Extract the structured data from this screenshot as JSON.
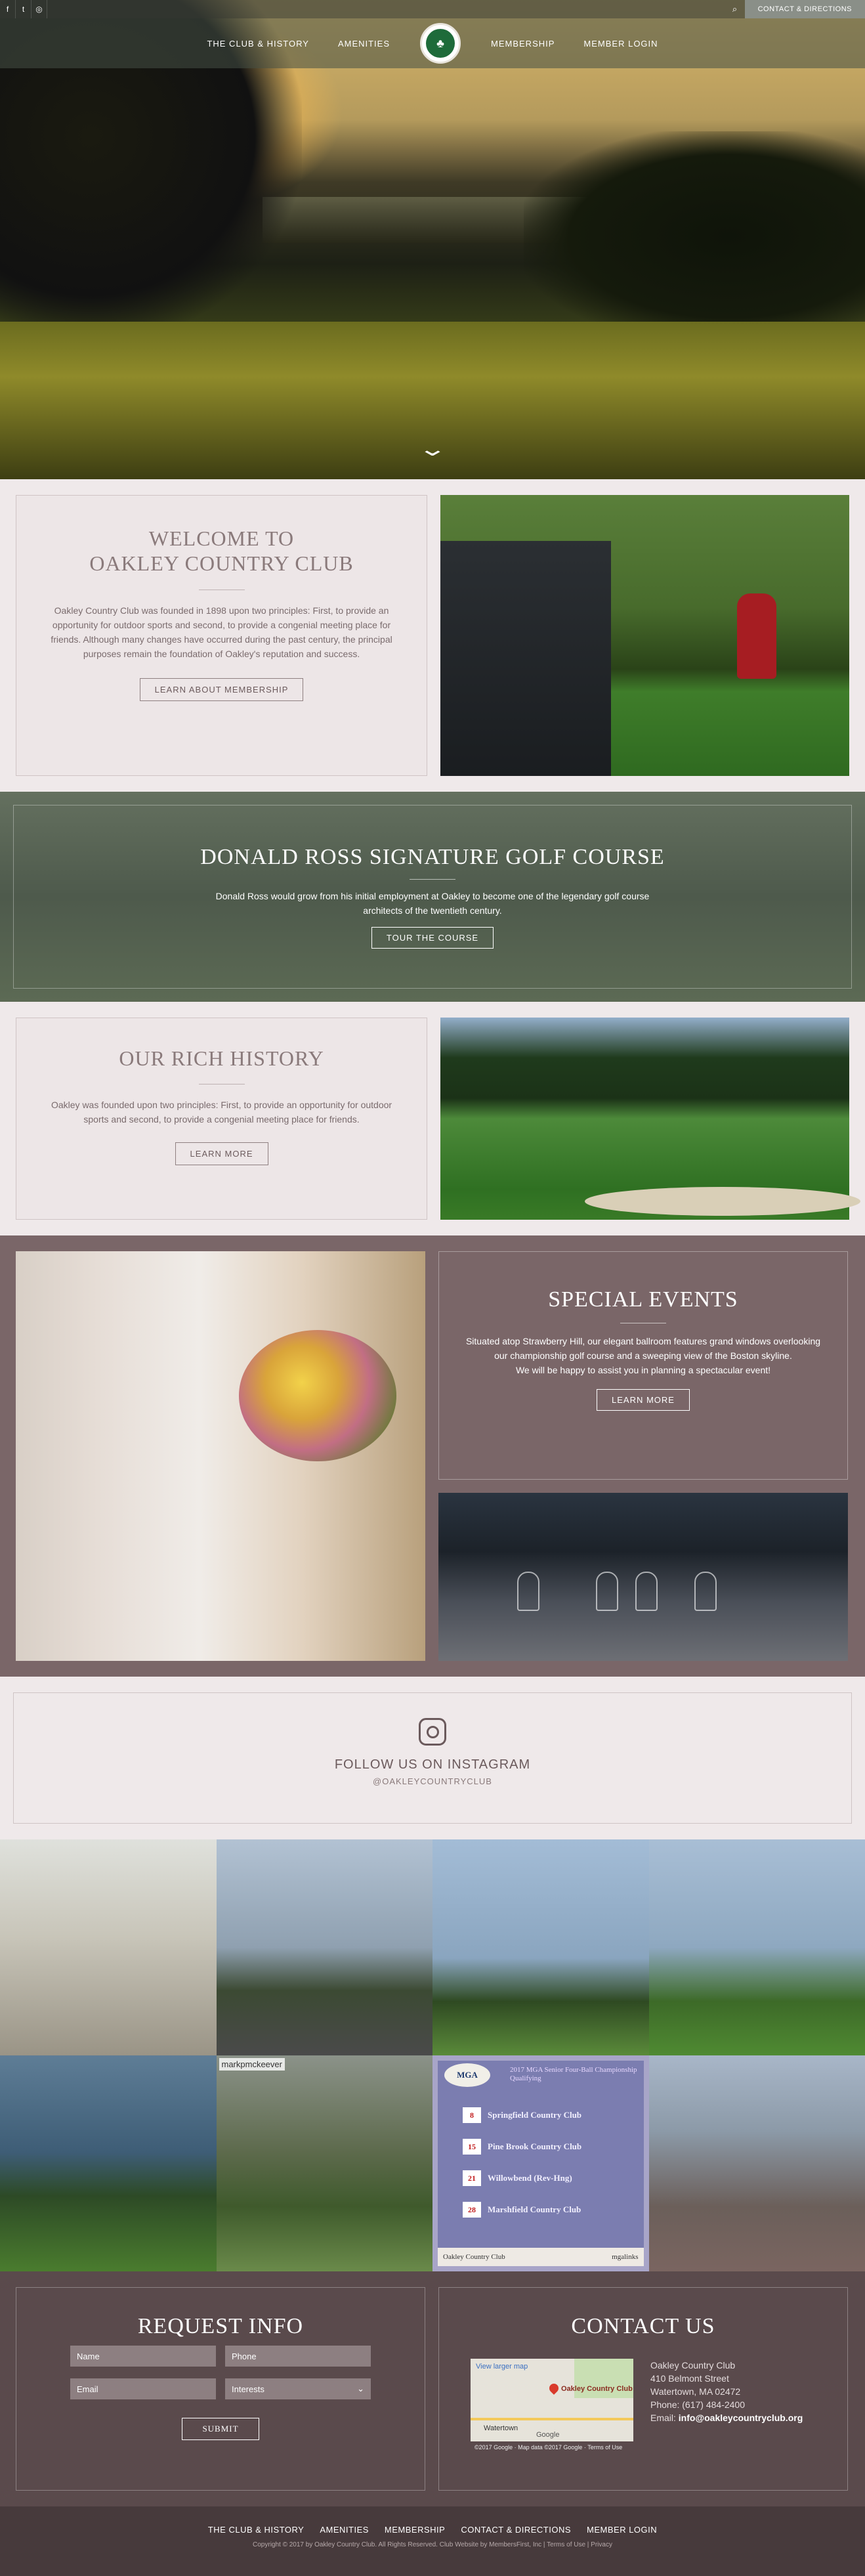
{
  "topbar": {
    "social": [
      {
        "icon": "facebook-icon",
        "glyph": "f"
      },
      {
        "icon": "twitter-icon",
        "glyph": "t"
      },
      {
        "icon": "instagram-icon",
        "glyph": "◎"
      }
    ],
    "search_icon": "⌕",
    "cta_label": "CONTACT & DIRECTIONS"
  },
  "nav": {
    "left": [
      "THE CLUB & HISTORY",
      "AMENITIES"
    ],
    "right": [
      "MEMBERSHIP",
      "MEMBER LOGIN"
    ],
    "crest_glyph": "♣"
  },
  "hero": {
    "chevron": "⌄"
  },
  "welcome": {
    "title_line1": "WELCOME TO",
    "title_line2": "OAKLEY COUNTRY CLUB",
    "body": "Oakley Country Club was founded in 1898 upon two principles: First, to provide an opportunity for outdoor sports and second, to provide a congenial meeting place for friends. Although many changes have occurred during the past century, the principal purposes remain the foundation of Oakley's reputation and success.",
    "button": "LEARN ABOUT MEMBERSHIP"
  },
  "ross": {
    "title": "DONALD ROSS SIGNATURE GOLF COURSE",
    "body": "Donald Ross would grow from his initial employment at Oakley to become one of the legendary golf course architects of the twentieth century.",
    "button": "TOUR THE COURSE"
  },
  "history": {
    "title": "OUR RICH HISTORY",
    "body": "Oakley was founded upon two principles: First, to provide an opportunity for outdoor sports and second, to provide a congenial meeting place for friends.",
    "button": "LEARN MORE"
  },
  "events": {
    "title": "SPECIAL EVENTS",
    "body1": "Situated atop Strawberry Hill, our elegant ballroom features grand windows overlooking our championship golf course and a sweeping view of the Boston skyline.",
    "body2": "We will be happy to assist you in planning a spectacular event!",
    "button": "LEARN MORE"
  },
  "instagram": {
    "title": "FOLLOW US ON INSTAGRAM",
    "handle": "@OAKLEYCOUNTRYCLUB",
    "tile_tag": "markpmckeever",
    "mga": {
      "logo": "MGA",
      "header": "2017 MGA Senior Four-Ball Championship Qualifying",
      "events": [
        {
          "day": "8",
          "club": "Springfield Country Club"
        },
        {
          "day": "15",
          "club": "Pine Brook Country Club"
        },
        {
          "day": "21",
          "club": "Willowbend (Rev-Hng)"
        },
        {
          "day": "28",
          "club": "Marshfield Country Club"
        }
      ],
      "footer_left": "Oakley Country Club",
      "footer_right": "mgalinks"
    }
  },
  "request": {
    "title": "REQUEST INFO",
    "fields": {
      "name": "Name",
      "phone": "Phone",
      "email": "Email",
      "interests": "Interests"
    },
    "submit": "SUBMIT"
  },
  "contact": {
    "title": "CONTACT US",
    "map": {
      "view_larger": "View larger map",
      "pin_label": "Oakley Country Club",
      "town": "Watertown",
      "google": "Google",
      "copyright": "©2017 Google · Map data ©2017 Google · Terms of Use"
    },
    "name": "Oakley Country Club",
    "street": "410 Belmont Street",
    "city": "Watertown, MA 02472",
    "phone": "Phone: (617) 484-2400",
    "email_prefix": "Email:",
    "email": "info@oakleycountryclub.org"
  },
  "footer": {
    "links": [
      "THE CLUB & HISTORY",
      "AMENITIES",
      "MEMBERSHIP",
      "CONTACT & DIRECTIONS",
      "MEMBER LOGIN"
    ],
    "copyright": "Copyright © 2017 by Oakley Country Club. All Rights Reserved. Club Website by MembersFirst, Inc | Terms of Use | Privacy"
  }
}
